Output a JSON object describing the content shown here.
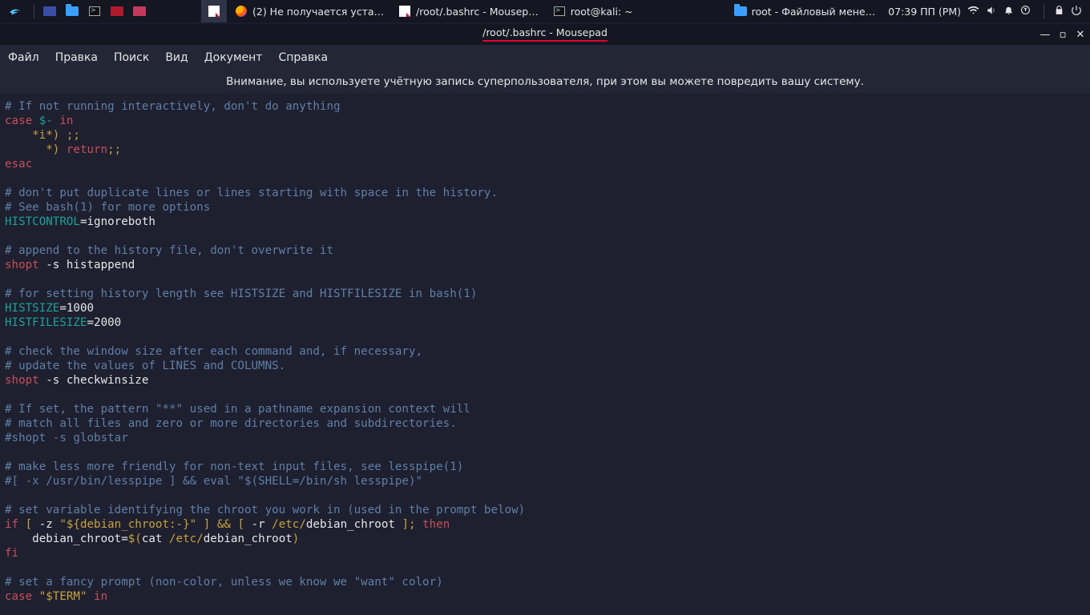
{
  "panel": {
    "tasks": [
      {
        "label": "(2) Не получается уста…",
        "kind": "firefox"
      },
      {
        "label": "/root/.bashrc - Mousep…",
        "kind": "notepad"
      },
      {
        "label": "root@kali: ~",
        "kind": "terminal"
      },
      {
        "label": "root - Файловый мене…",
        "kind": "folder"
      }
    ],
    "clock": "07:39 ПП (PM)"
  },
  "window": {
    "title": "/root/.bashrc - Mousepad",
    "menu": [
      "Файл",
      "Правка",
      "Поиск",
      "Вид",
      "Документ",
      "Справка"
    ],
    "warning": "Внимание, вы используете учётную запись суперпользователя, при этом вы можете повредить вашу систему."
  },
  "code": {
    "l01": "# If not running interactively, don't do anything",
    "l02a": "case ",
    "l02b": "$-",
    "l02c": " in",
    "l03a": "    *i*) ",
    "l03b": ";;",
    "l04a": "      *) ",
    "l04b": "return",
    "l04c": ";;",
    "l05": "esac",
    "l07": "# don't put duplicate lines or lines starting with space in the history.",
    "l08": "# See bash(1) for more options",
    "l09a": "HISTCONTROL",
    "l09b": "=ignoreboth",
    "l11": "# append to the history file, don't overwrite it",
    "l12a": "shopt",
    "l12b": " -s histappend",
    "l14": "# for setting history length see HISTSIZE and HISTFILESIZE in bash(1)",
    "l15a": "HISTSIZE",
    "l15b": "=1000",
    "l16a": "HISTFILESIZE",
    "l16b": "=2000",
    "l18": "# check the window size after each command and, if necessary,",
    "l19": "# update the values of LINES and COLUMNS.",
    "l20a": "shopt",
    "l20b": " -s checkwinsize",
    "l22": "# If set, the pattern \"**\" used in a pathname expansion context will",
    "l23": "# match all files and zero or more directories and subdirectories.",
    "l24": "#shopt -s globstar",
    "l26": "# make less more friendly for non-text input files, see lesspipe(1)",
    "l27": "#[ -x /usr/bin/lesspipe ] && eval \"$(SHELL=/bin/sh lesspipe)\"",
    "l29": "# set variable identifying the chroot you work in (used in the prompt below)",
    "l30a": "if",
    "l30b": " [ ",
    "l30c": "-z ",
    "l30d": "\"${debian_chroot:-}\"",
    "l30e": " ] ",
    "l30f": "&&",
    "l30g": " [ ",
    "l30h": "-r ",
    "l30i": "/etc/",
    "l30j": "debian_chroot",
    "l30k": " ]; ",
    "l30l": "then",
    "l31a": "    debian_chroot=",
    "l31b": "$(",
    "l31c": "cat ",
    "l31d": "/etc/",
    "l31e": "debian_chroot",
    "l31f": ")",
    "l32": "fi",
    "l34": "# set a fancy prompt (non-color, unless we know we \"want\" color)",
    "l35a": "case ",
    "l35b": "\"$TERM\"",
    "l35c": " in"
  }
}
